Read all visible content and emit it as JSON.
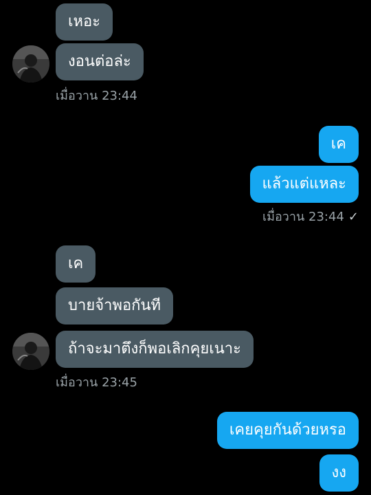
{
  "conversation": {
    "messages": [
      {
        "side": "in",
        "text": "เหอะ"
      },
      {
        "side": "in",
        "text": "งอนต่อล่ะ"
      },
      {
        "side": "out",
        "text": "เค"
      },
      {
        "side": "out",
        "text": "แล้วแต่แหละ"
      },
      {
        "side": "in",
        "text": "เค"
      },
      {
        "side": "in",
        "text": "บายจ้าพอกันที"
      },
      {
        "side": "in",
        "text": "ถ้าจะมาตึงก็พอเลิกคุยเนาะ"
      },
      {
        "side": "out",
        "text": "เคยคุยกันด้วยหรอ"
      },
      {
        "side": "out",
        "text": "งง"
      }
    ],
    "timestamps": {
      "ts1": "เมื่อวาน 23:44",
      "ts2": "เมื่อวาน 23:44",
      "ts3": "เมื่อวาน 23:45"
    },
    "read_check": "✓",
    "colors": {
      "background": "#000000",
      "incoming_bubble": "#4a5a63",
      "outgoing_bubble": "#16a7f1",
      "timestamp": "#9aa3a8"
    },
    "icons": {
      "avatar": "contact-avatar-photo",
      "read": "check-icon"
    }
  }
}
